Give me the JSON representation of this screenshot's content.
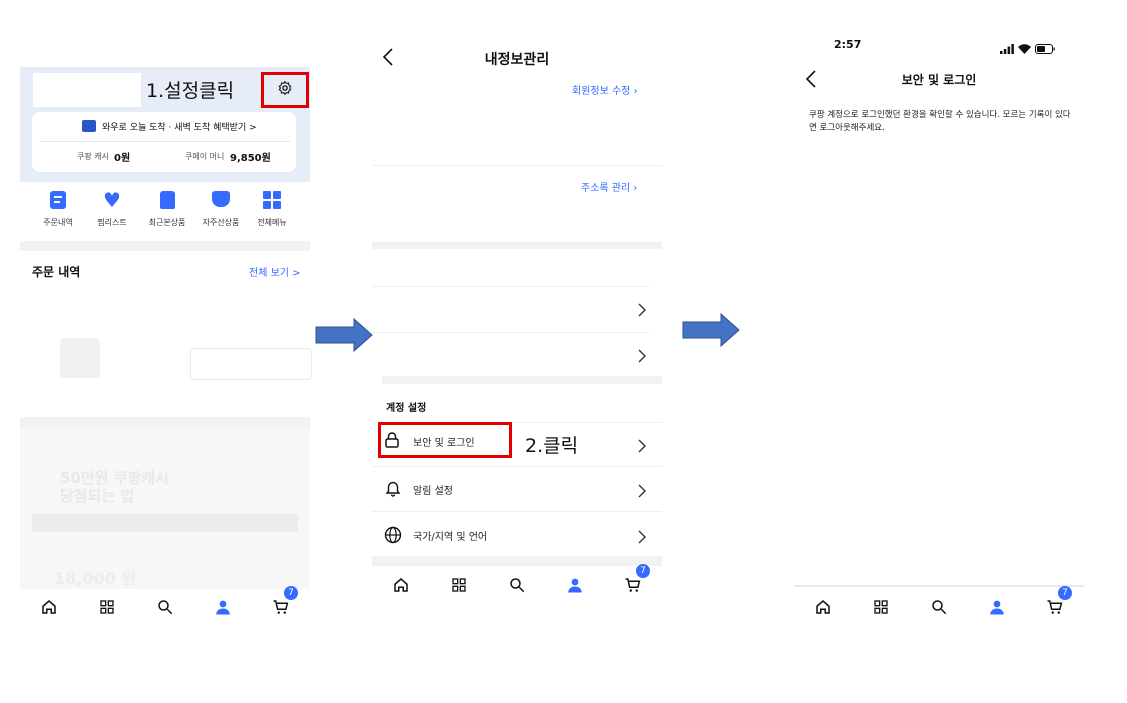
{
  "panel1": {
    "annotation_step1": "1.설정클릭",
    "promo_text": "와우로 오늘 도착 · 새벽 도착 혜택받기 >",
    "cash_label": "쿠팡 캐시",
    "cash_value": "0원",
    "pay_label": "쿠페이 머니",
    "pay_value": "9,850원",
    "menu": [
      {
        "label": "주문내역",
        "icon": "receipt-icon"
      },
      {
        "label": "찜리스트",
        "icon": "heart-icon"
      },
      {
        "label": "최근본상품",
        "icon": "recent-bag-icon"
      },
      {
        "label": "자주산상품",
        "icon": "cart-repeat-icon"
      },
      {
        "label": "전체메뉴",
        "icon": "grid-icon"
      }
    ],
    "orders_title": "주문 내역",
    "orders_view_all": "전체 보기 >",
    "faded_text1": "50만원 쿠팡캐시",
    "faded_text2": "당첨되는 법",
    "faded_price": "18,000 원",
    "cart_count": "7"
  },
  "panel2": {
    "title": "내정보관리",
    "edit_member": "회원정보 수정",
    "address_manage": "주소록 관리",
    "account_section": "계정 설정",
    "rows": [
      {
        "label": "보안 및 로그인",
        "icon": "lock-icon"
      },
      {
        "label": "알림 설정",
        "icon": "bell-icon"
      },
      {
        "label": "국가/지역 및 언어",
        "icon": "globe-icon"
      }
    ],
    "annotation_step2": "2.클릭",
    "cart_count": "7"
  },
  "panel3": {
    "status_time": "2:57",
    "title": "보안 및 로그인",
    "description": "쿠팡 계정으로 로그인했던 환경을 확인할 수 있습니다. 모르는 기록이 있다면 로그아웃해주세요.",
    "cart_count": "7"
  },
  "colors": {
    "accent": "#346aff",
    "annotation_red": "#e00000",
    "arrow_blue": "#4472c4"
  }
}
